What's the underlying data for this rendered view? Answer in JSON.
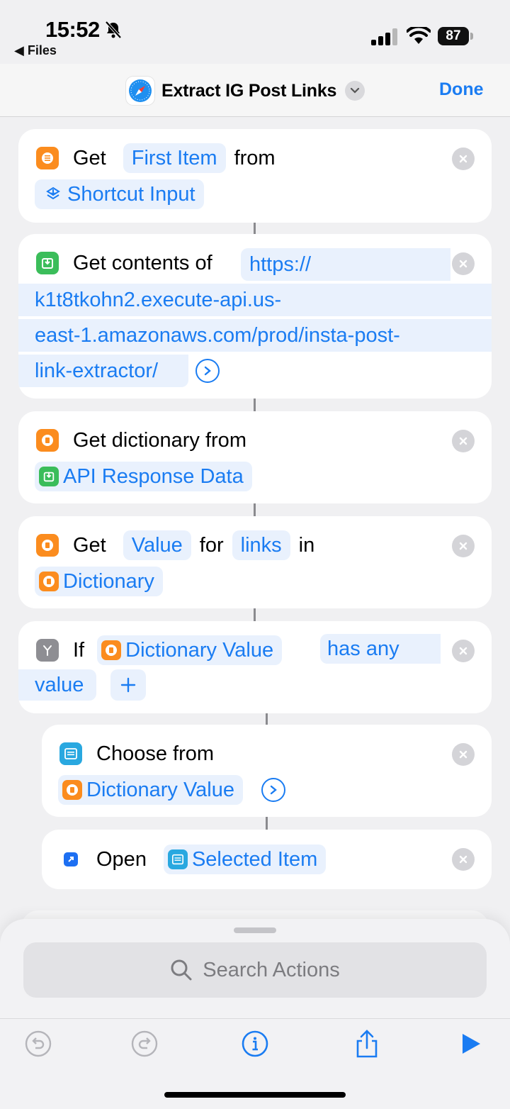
{
  "status_bar": {
    "time": "15:52",
    "back_app": "◀ Files",
    "battery": "87"
  },
  "nav": {
    "title": "Extract IG Post Links",
    "done_label": "Done"
  },
  "actions": {
    "get_item": {
      "verb": "Get",
      "chip_item": "First Item",
      "from_label": "from",
      "chip_input": "Shortcut Input"
    },
    "get_contents": {
      "verb": "Get contents of",
      "url_lines": [
        "https://",
        "k1t8tkohn2.execute-api.us-",
        "east-1.amazonaws.com/prod/insta-post-",
        "link-extractor/"
      ]
    },
    "get_dictionary": {
      "verb": "Get dictionary from",
      "chip_source": "API Response Data"
    },
    "get_value": {
      "verb": "Get",
      "chip_value": "Value",
      "for_label": "for",
      "chip_key": "links",
      "in_label": "in",
      "chip_dict": "Dictionary"
    },
    "if_block": {
      "verb": "If",
      "chip_var": "Dictionary Value",
      "chip_cond": "has any",
      "chip_value": "value"
    },
    "choose_from": {
      "verb": "Choose from",
      "chip_list": "Dictionary Value"
    },
    "open": {
      "verb": "Open",
      "chip_item": "Selected Item"
    }
  },
  "sheet": {
    "search_placeholder": "Search Actions"
  },
  "colors": {
    "accent": "#1a7cf2",
    "chip_bg": "#e9f1fd",
    "orange": "#fb8c1e",
    "green": "#3bbd5a"
  }
}
